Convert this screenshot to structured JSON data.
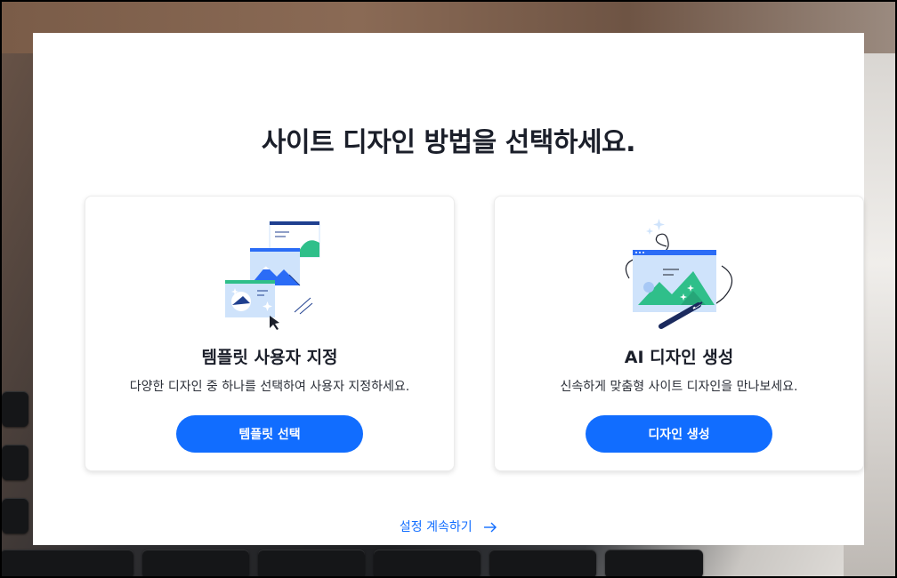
{
  "page": {
    "heading": "사이트 디자인 방법을 선택하세요."
  },
  "cards": [
    {
      "title": "템플릿 사용자 지정",
      "description": "다양한 디자인 중 하나를 선택하여 사용자 지정하세요.",
      "button_label": "템플릿 선택",
      "illustration": "template-illustration-icon"
    },
    {
      "title": "AI 디자인 생성",
      "description": "신속하게 맞춤형 사이트 디자인을 만나보세요.",
      "button_label": "디자인 생성",
      "illustration": "ai-design-illustration-icon"
    }
  ],
  "continue_link": {
    "label": "설정 계속하기",
    "icon": "arrow-right-icon"
  },
  "colors": {
    "accent": "#116dff",
    "heading_text": "#1b1f2a",
    "illustration_blue": "#2b6cf6",
    "illustration_green": "#2fbf8a",
    "illustration_light": "#cfe3fb"
  }
}
